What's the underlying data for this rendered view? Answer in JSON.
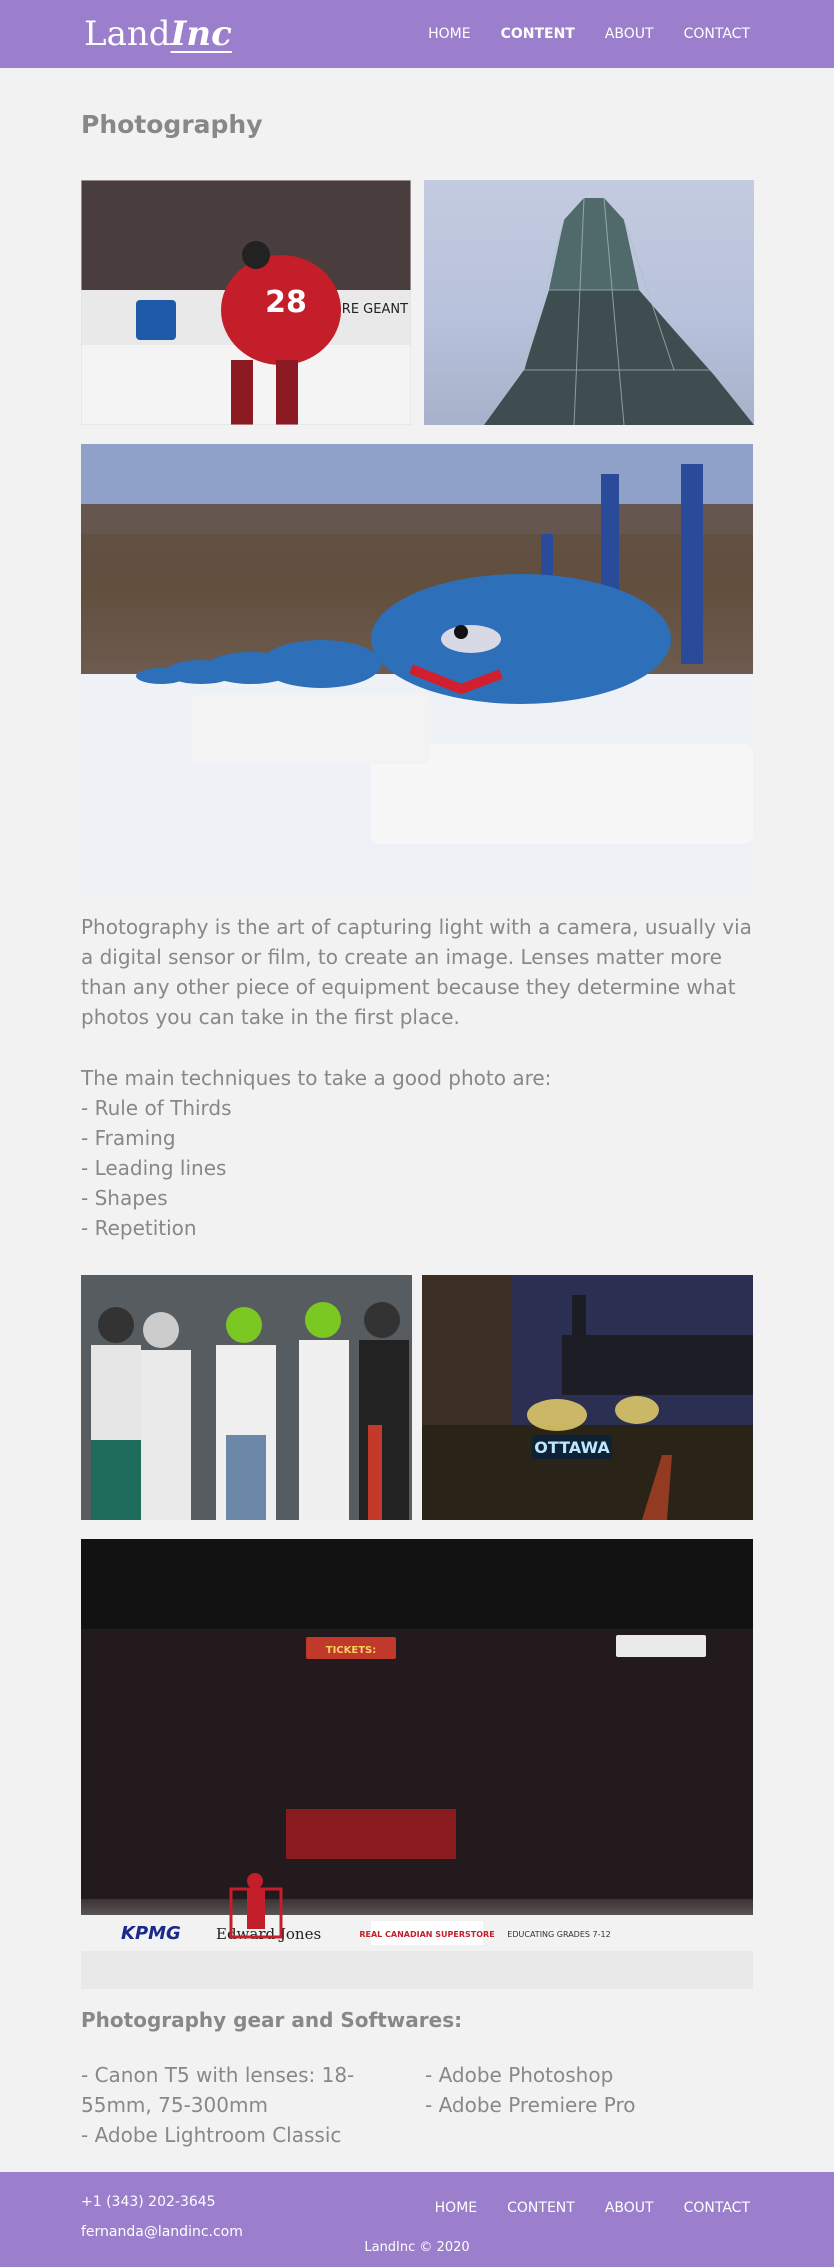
{
  "header": {
    "logo_part1": "Land",
    "logo_part2": "Inc",
    "nav": [
      {
        "label": "HOME"
      },
      {
        "label": "CONTENT",
        "active": true
      },
      {
        "label": "ABOUT"
      },
      {
        "label": "CONTACT"
      }
    ]
  },
  "main": {
    "title": "Photography",
    "description": "Photography is the art of capturing light with a camera, usually via a digital sensor or film, to create an image. Lenses matter more than any other piece of equipment because they determine what photos you can take in the first place.",
    "techniques_intro": "The main techniques to take a good photo are:",
    "techniques": [
      "- Rule of Thirds",
      "- Framing",
      "- Leading lines",
      "- Shapes",
      "- Repetition"
    ],
    "gear_title": "Photography gear and Softwares:",
    "gear_left": [
      "- Canon T5 with lenses: 18-55mm, 75-300mm",
      "- Adobe Lightroom Classic"
    ],
    "gear_right": [
      "- Adobe Photoshop",
      "- Adobe Premiere Pro"
    ],
    "photo_texts": {
      "hockey_jersey": "28",
      "hockey_ad": "TIGRE GEANT",
      "ottawa_sign": "OTTAWA",
      "arena_tickets": "TICKETS:",
      "arena_ad1": "KPMG",
      "arena_ad2": "Edward Jones",
      "arena_ad3": "REAL CANADIAN SUPERSTORE",
      "arena_ad4": "EDUCATING GRADES 7-12"
    }
  },
  "footer": {
    "phone": "+1 (343) 202-3645",
    "email": "fernanda@landinc.com",
    "nav": [
      {
        "label": "HOME"
      },
      {
        "label": "CONTENT"
      },
      {
        "label": "ABOUT"
      },
      {
        "label": "CONTACT"
      }
    ],
    "copyright": "LandInc © 2020"
  },
  "colors": {
    "header_bg": "#9b7fcc",
    "page_bg": "#f2f2f2",
    "text": "#888888"
  }
}
